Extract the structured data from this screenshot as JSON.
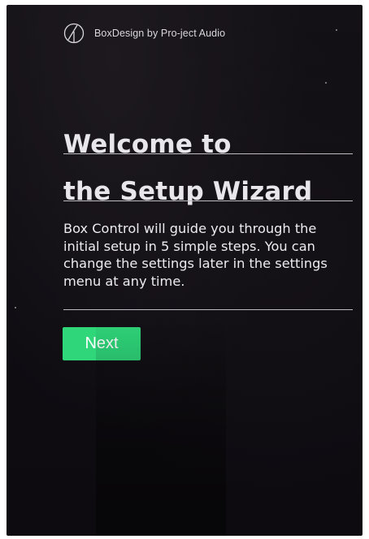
{
  "header": {
    "brand": "BoxDesign by Pro-ject Audio",
    "logo_icon": "pro-ject-logo-icon"
  },
  "main": {
    "title_line_1": "Welcome to",
    "title_line_2": "the Setup Wizard",
    "description": "Box Control will guide you through the initial setup in 5 simple steps. You can change the settings later in the settings menu at any time.",
    "next_label": "Next"
  },
  "colors": {
    "background": "#121016",
    "text": "#e8e6ea",
    "accent": "#2fd67a"
  }
}
